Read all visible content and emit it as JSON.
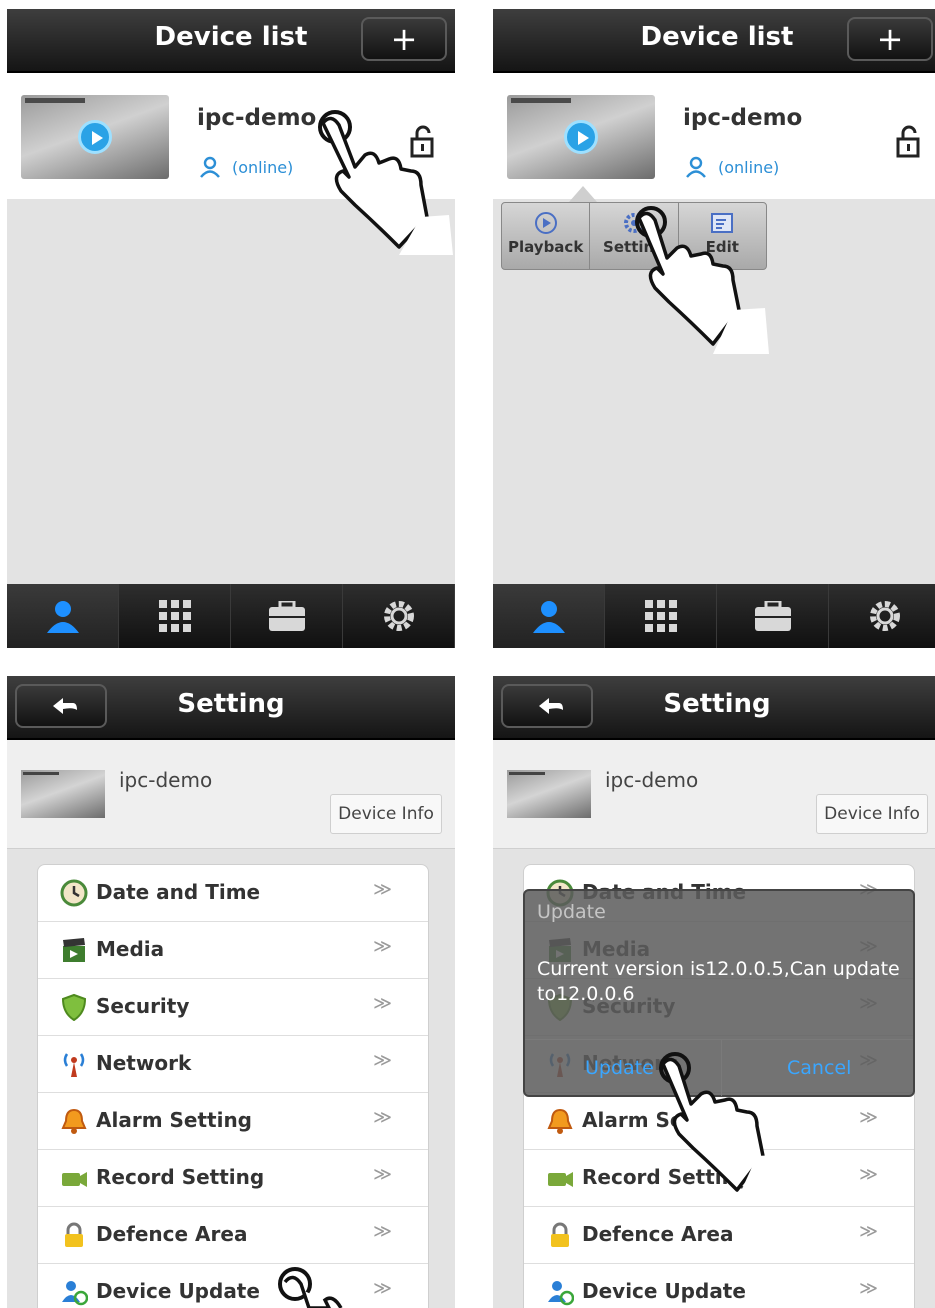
{
  "device_list": {
    "title": "Device list",
    "add_label": "+",
    "device": {
      "name": "ipc-demo",
      "status": "(online)"
    }
  },
  "popup_menu": {
    "playback": "Playback",
    "setting": "Setting",
    "edit": "Edit"
  },
  "tabbar": [
    "person-icon",
    "grid-icon",
    "toolbox-icon",
    "gear-icon"
  ],
  "setting": {
    "title": "Setting",
    "device_name": "ipc-demo",
    "device_info_label": "Device Info",
    "items": [
      {
        "label": "Date and Time",
        "icon": "clock-icon"
      },
      {
        "label": "Media",
        "icon": "clapper-icon"
      },
      {
        "label": "Security",
        "icon": "shield-icon"
      },
      {
        "label": "Network",
        "icon": "antenna-icon"
      },
      {
        "label": "Alarm Setting",
        "icon": "bell-icon"
      },
      {
        "label": "Record Setting",
        "icon": "camera-icon"
      },
      {
        "label": "Defence Area",
        "icon": "lock-icon"
      },
      {
        "label": "Device Update",
        "icon": "user-sync-icon"
      }
    ],
    "arrow": "≫"
  },
  "update_dialog": {
    "title": "Update",
    "message": "Current version is12.0.0.5,Can update to12.0.0.6",
    "update_label": "Update",
    "cancel_label": "Cancel"
  },
  "colors": {
    "accent": "#2c8fd6",
    "topbar": "#1b1b1b",
    "dialog_button": "#3aa6ff"
  }
}
